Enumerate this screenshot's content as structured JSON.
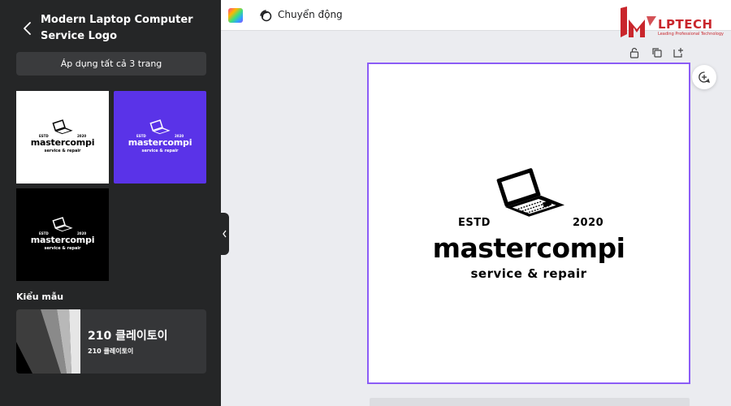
{
  "sidebar": {
    "title": "Modern Laptop Computer Service Logo",
    "apply_button": "Áp dụng tất cả 3 trang",
    "variants": [
      {
        "theme": "white",
        "bg": "#ffffff",
        "fg": "#000000"
      },
      {
        "theme": "purple",
        "bg": "#5a33e8",
        "fg": "#ffffff"
      },
      {
        "theme": "black",
        "bg": "#000000",
        "fg": "#ffffff"
      }
    ],
    "section_label": "Kiểu mẫu",
    "template": {
      "title": "210 클레이토이",
      "subtitle": "210 클레이토이"
    }
  },
  "topbar": {
    "motion_label": "Chuyển động"
  },
  "watermark": {
    "brand": "LPTECH",
    "tagline": "Leading Professional Technology",
    "color": "#c9262c"
  },
  "logo": {
    "estd": "ESTD",
    "year": "2020",
    "brand": "mastercompi",
    "tagline": "service & repair"
  },
  "colors": {
    "sidebar_bg": "#252627",
    "canvas_border": "#8b5cf6",
    "workspace_bg": "#ebecf0"
  },
  "icons": [
    "chevron-left-icon",
    "color-palette-icon",
    "motion-icon",
    "lock-icon",
    "duplicate-icon",
    "add-page-icon",
    "comment-add-icon",
    "laptop-icon",
    "chevron-collapse-icon"
  ]
}
